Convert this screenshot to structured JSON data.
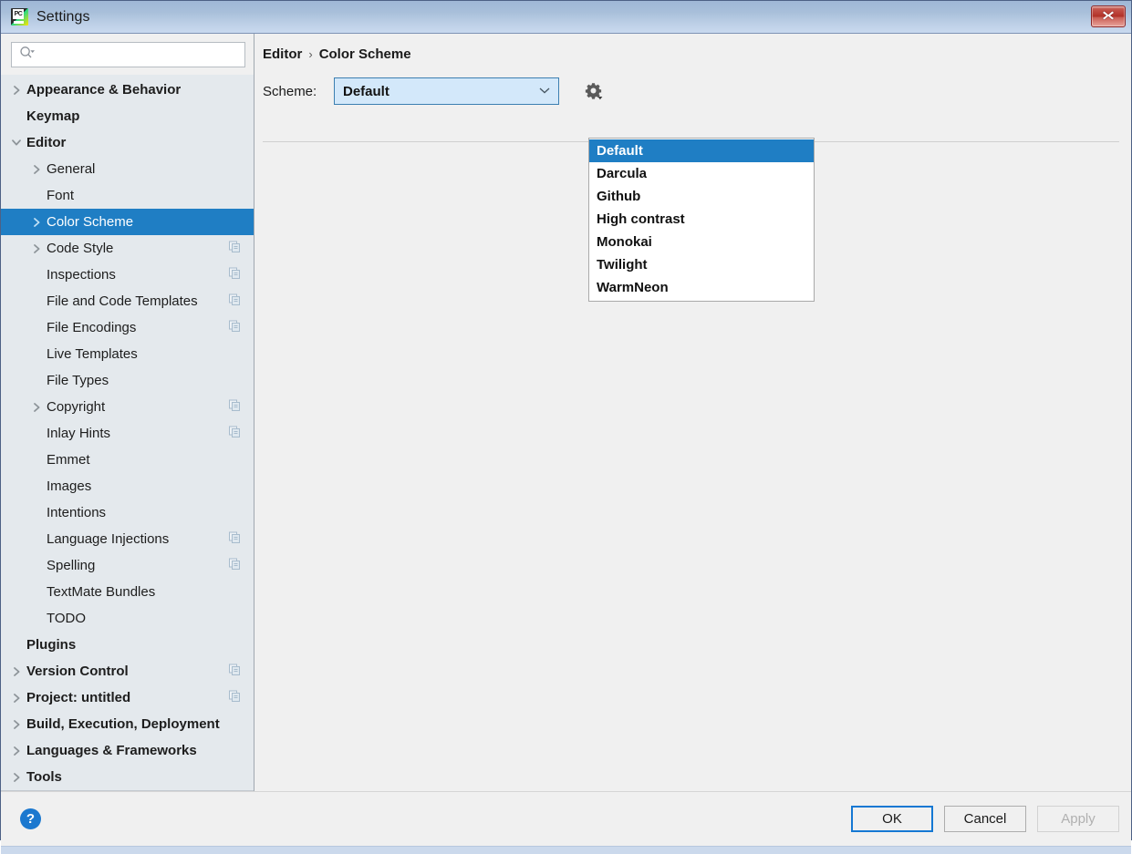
{
  "window": {
    "title": "Settings",
    "app_icon": "pycharm-icon",
    "icon_text": "PC",
    "close_icon": "close-icon"
  },
  "search": {
    "value": "",
    "placeholder": "",
    "icon": "search-icon"
  },
  "sidebar": {
    "items": [
      {
        "label": "Appearance & Behavior",
        "level": 0,
        "arrow": "collapsed",
        "bold": true,
        "badge": false
      },
      {
        "label": "Keymap",
        "level": 0,
        "arrow": "none",
        "bold": true,
        "badge": false
      },
      {
        "label": "Editor",
        "level": 0,
        "arrow": "expanded",
        "bold": true,
        "badge": false
      },
      {
        "label": "General",
        "level": 1,
        "arrow": "collapsed",
        "bold": false,
        "badge": false
      },
      {
        "label": "Font",
        "level": 1,
        "arrow": "none",
        "bold": false,
        "badge": false
      },
      {
        "label": "Color Scheme",
        "level": 1,
        "arrow": "collapsed",
        "bold": false,
        "badge": false,
        "selected": true
      },
      {
        "label": "Code Style",
        "level": 1,
        "arrow": "collapsed",
        "bold": false,
        "badge": true
      },
      {
        "label": "Inspections",
        "level": 1,
        "arrow": "none",
        "bold": false,
        "badge": true
      },
      {
        "label": "File and Code Templates",
        "level": 1,
        "arrow": "none",
        "bold": false,
        "badge": true
      },
      {
        "label": "File Encodings",
        "level": 1,
        "arrow": "none",
        "bold": false,
        "badge": true
      },
      {
        "label": "Live Templates",
        "level": 1,
        "arrow": "none",
        "bold": false,
        "badge": false
      },
      {
        "label": "File Types",
        "level": 1,
        "arrow": "none",
        "bold": false,
        "badge": false
      },
      {
        "label": "Copyright",
        "level": 1,
        "arrow": "collapsed",
        "bold": false,
        "badge": true
      },
      {
        "label": "Inlay Hints",
        "level": 1,
        "arrow": "none",
        "bold": false,
        "badge": true
      },
      {
        "label": "Emmet",
        "level": 1,
        "arrow": "none",
        "bold": false,
        "badge": false
      },
      {
        "label": "Images",
        "level": 1,
        "arrow": "none",
        "bold": false,
        "badge": false
      },
      {
        "label": "Intentions",
        "level": 1,
        "arrow": "none",
        "bold": false,
        "badge": false
      },
      {
        "label": "Language Injections",
        "level": 1,
        "arrow": "none",
        "bold": false,
        "badge": true
      },
      {
        "label": "Spelling",
        "level": 1,
        "arrow": "none",
        "bold": false,
        "badge": true
      },
      {
        "label": "TextMate Bundles",
        "level": 1,
        "arrow": "none",
        "bold": false,
        "badge": false
      },
      {
        "label": "TODO",
        "level": 1,
        "arrow": "none",
        "bold": false,
        "badge": false
      },
      {
        "label": "Plugins",
        "level": 0,
        "arrow": "none",
        "bold": true,
        "badge": false
      },
      {
        "label": "Version Control",
        "level": 0,
        "arrow": "collapsed",
        "bold": true,
        "badge": true
      },
      {
        "label": "Project: untitled",
        "level": 0,
        "arrow": "collapsed",
        "bold": true,
        "badge": true
      },
      {
        "label": "Build, Execution, Deployment",
        "level": 0,
        "arrow": "collapsed",
        "bold": true,
        "badge": false
      },
      {
        "label": "Languages & Frameworks",
        "level": 0,
        "arrow": "collapsed",
        "bold": true,
        "badge": false
      },
      {
        "label": "Tools",
        "level": 0,
        "arrow": "collapsed",
        "bold": true,
        "badge": false
      }
    ]
  },
  "breadcrumb": {
    "root": "Editor",
    "separator": "›",
    "current": "Color Scheme"
  },
  "scheme": {
    "label": "Scheme:",
    "selected": "Default",
    "gear_icon": "gear-icon",
    "chevron_icon": "chevron-down-icon",
    "options": [
      "Default",
      "Darcula",
      "Github",
      "High contrast",
      "Monokai",
      "Twilight",
      "WarmNeon"
    ]
  },
  "footer": {
    "help_icon": "?",
    "ok_label": "OK",
    "cancel_label": "Cancel",
    "apply_label": "Apply"
  },
  "colors": {
    "selection_blue": "#1f7ec4",
    "sidebar_bg": "#e4e9ed",
    "panel_bg": "#f0f0f0",
    "combo_bg": "#d3e8fa",
    "combo_border": "#3c7fb1",
    "focus_border": "#1578d3",
    "help_blue": "#1b78cf",
    "titlebar_top": "#9fb7d6",
    "titlebar_bottom": "#c9d9ef",
    "close_red": "#b02f26"
  }
}
